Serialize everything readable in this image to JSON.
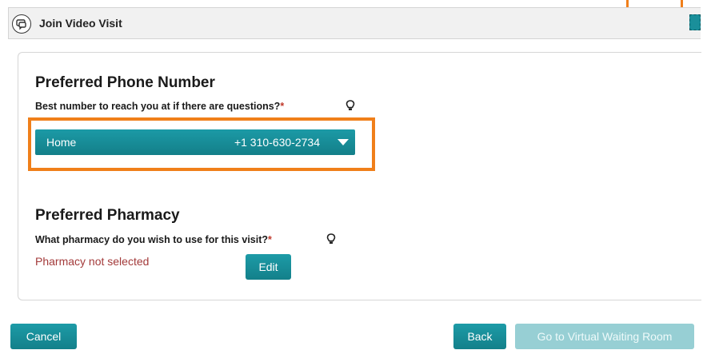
{
  "window": {
    "title": "Join Video Visit"
  },
  "phone": {
    "heading": "Preferred Phone Number",
    "question": "Best number to reach you at if there are questions?",
    "required_mark": "*",
    "selected_label": "Home",
    "selected_number": "+1 310-630-2734"
  },
  "pharmacy": {
    "heading": "Preferred Pharmacy",
    "question": "What pharmacy do you wish to use for this visit?",
    "required_mark": "*",
    "status": "Pharmacy not selected",
    "edit_label": "Edit"
  },
  "footer": {
    "cancel_label": "Cancel",
    "back_label": "Back",
    "go_label": "Go to Virtual Waiting Room"
  },
  "colors": {
    "accent": "#1a8f9a",
    "highlight": "#f07f1a",
    "error_text": "#a33a3a"
  },
  "icons": [
    "video-visit-icon",
    "close-icon",
    "lightbulb-icon",
    "chevron-down-icon"
  ]
}
